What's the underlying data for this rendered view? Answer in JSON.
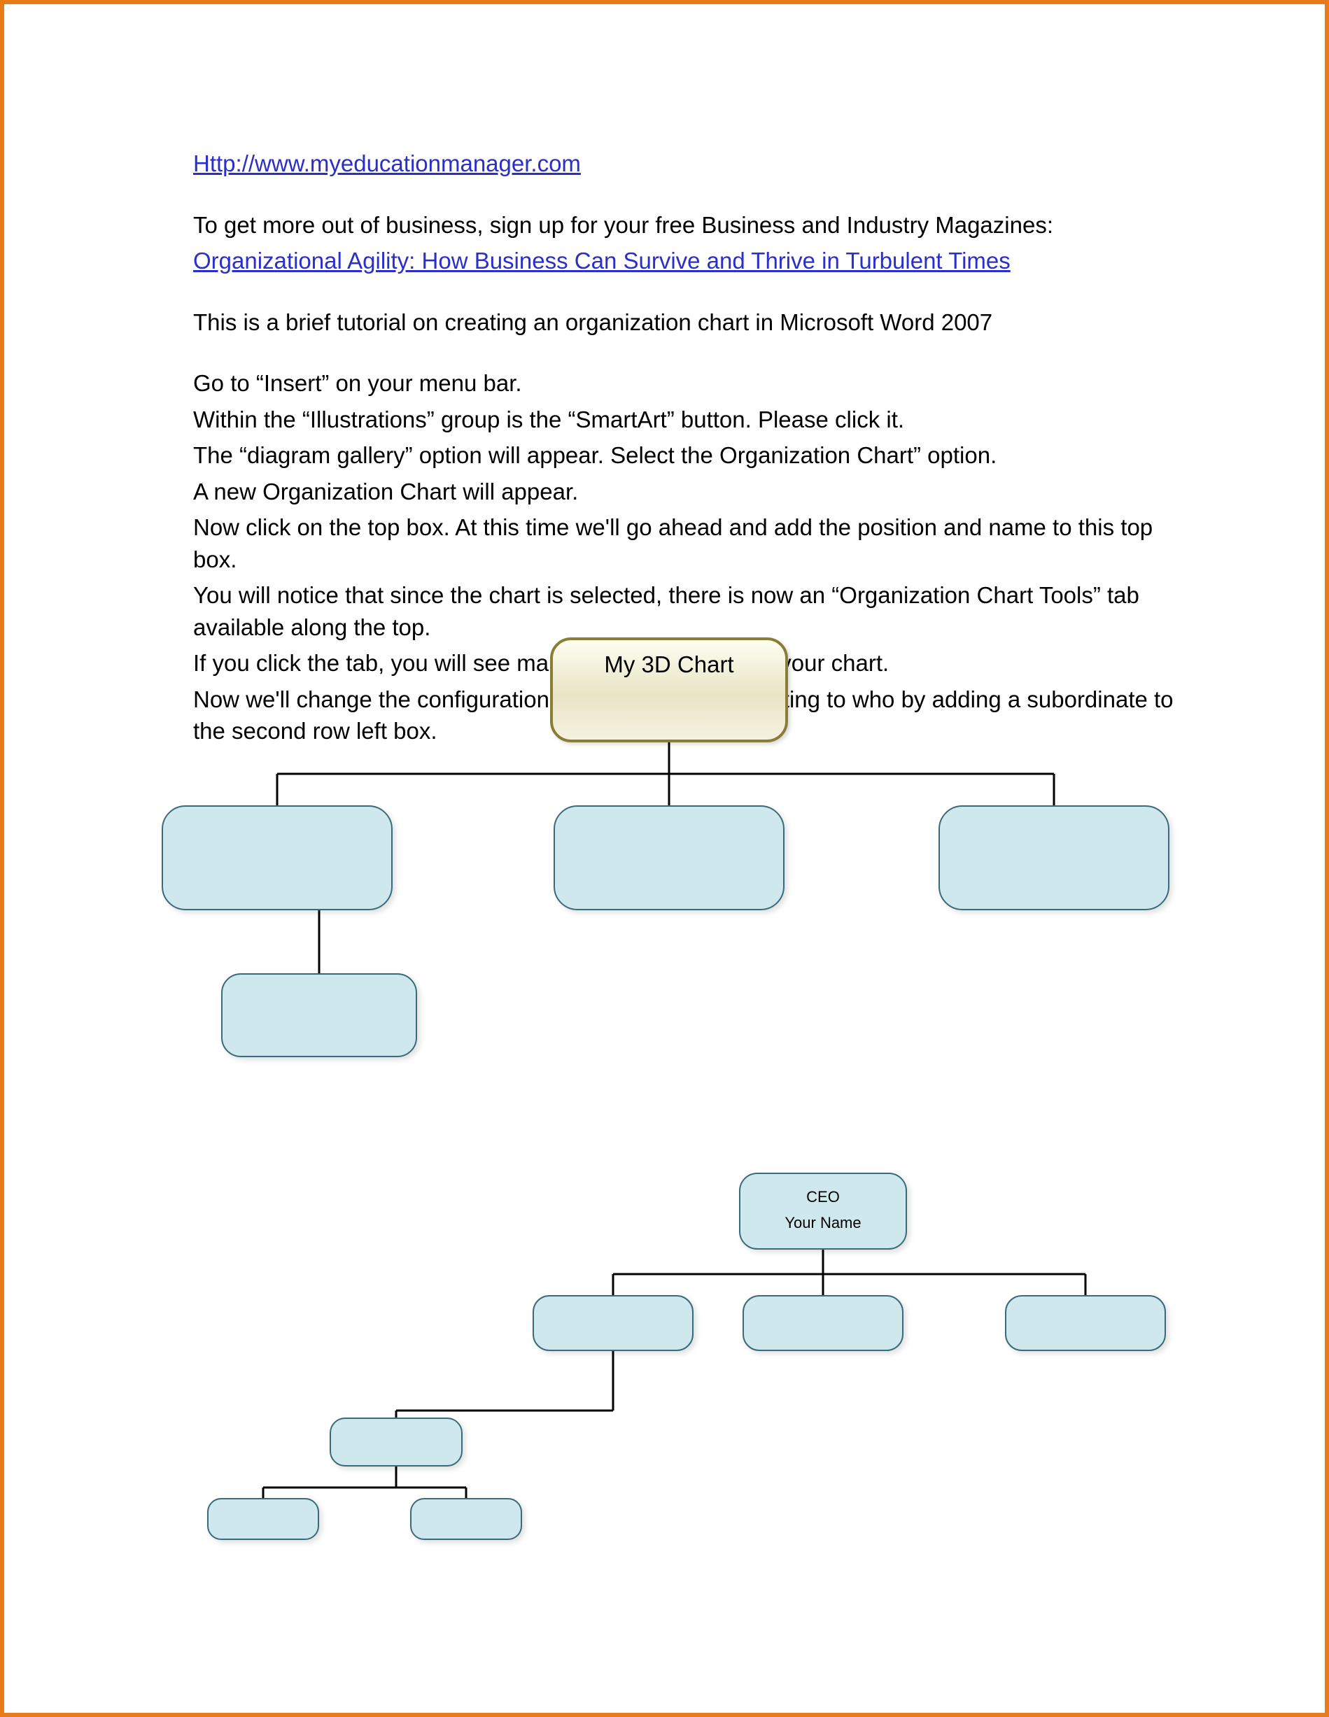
{
  "header": {
    "url": "Http://www.myeducationmanager.com"
  },
  "intro": {
    "prompt": "To get more out of business, sign up for your free Business and Industry Magazines:",
    "link2": "Organizational Agility: How Business Can Survive and Thrive in Turbulent Times",
    "title": "This is a brief tutorial on creating an organization chart in Microsoft Word 2007"
  },
  "steps": {
    "s1": "Go to “Insert” on your menu bar.",
    "s2": "Within the “Illustrations” group is the “SmartArt” button. Please click it.",
    "s3": "The “diagram gallery” option will appear. Select the Organization Chart” option.",
    "s4": "A new Organization Chart will appear.",
    "s5": "Now click on the top box. At this time we'll go ahead and add the position and name to this top box.",
    "s6": "You will notice that since the chart is selected, there is now an “Organization Chart Tools” tab available along the top.",
    "s7": "If you click the tab, you will see many options for building your chart.",
    "s8": "Now we'll change the configuration based on who is reporting to who by adding a subordinate to the second row left box."
  },
  "chart1": {
    "root_label": "My 3D Chart"
  },
  "chart2": {
    "root_line1": "CEO",
    "root_line2": "Your Name"
  },
  "chart_data": [
    {
      "type": "org-chart",
      "title": "My 3D Chart",
      "nodes": [
        {
          "id": "root",
          "label": "My 3D Chart",
          "parent": null
        },
        {
          "id": "r2a",
          "label": "",
          "parent": "root"
        },
        {
          "id": "r2b",
          "label": "",
          "parent": "root"
        },
        {
          "id": "r2c",
          "label": "",
          "parent": "root"
        },
        {
          "id": "r3a",
          "label": "",
          "parent": "r2a"
        }
      ]
    },
    {
      "type": "org-chart",
      "title": "CEO / Your Name",
      "nodes": [
        {
          "id": "root",
          "label": "CEO\nYour Name",
          "parent": null
        },
        {
          "id": "c1",
          "label": "",
          "parent": "root"
        },
        {
          "id": "c2",
          "label": "",
          "parent": "root"
        },
        {
          "id": "c3",
          "label": "",
          "parent": "root"
        },
        {
          "id": "s1",
          "label": "",
          "parent": "c1"
        },
        {
          "id": "t1",
          "label": "",
          "parent": "s1"
        },
        {
          "id": "t2",
          "label": "",
          "parent": "s1"
        }
      ]
    }
  ]
}
